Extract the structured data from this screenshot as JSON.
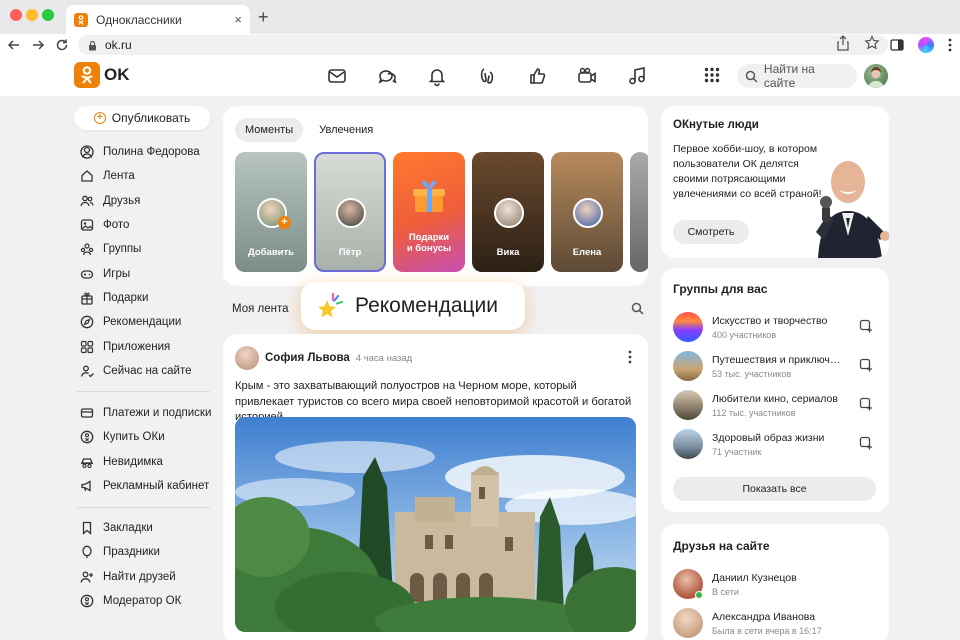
{
  "browser": {
    "tab_title": "Одноклассники",
    "tab_close": "×",
    "new_tab": "+",
    "url": "ok.ru"
  },
  "header": {
    "logo_text": "OK",
    "search_placeholder": "Найти на сайте",
    "icons": [
      "messages-icon",
      "discussions-icon",
      "notifications-icon",
      "guests-icon",
      "likes-icon",
      "video-icon",
      "music-icon"
    ]
  },
  "sidebar": {
    "publish_label": "Опубликовать",
    "group1": [
      {
        "label": "Полина Федорова",
        "icon": "profile-icon"
      },
      {
        "label": "Лента",
        "icon": "home-icon"
      },
      {
        "label": "Друзья",
        "icon": "friends-icon"
      },
      {
        "label": "Фото",
        "icon": "photo-icon"
      },
      {
        "label": "Группы",
        "icon": "groups-icon"
      },
      {
        "label": "Игры",
        "icon": "games-icon"
      },
      {
        "label": "Подарки",
        "icon": "gift-icon"
      },
      {
        "label": "Рекомендации",
        "icon": "compass-icon"
      },
      {
        "label": "Приложения",
        "icon": "apps-icon"
      },
      {
        "label": "Сейчас на сайте",
        "icon": "online-icon"
      }
    ],
    "group2": [
      {
        "label": "Платежи и подписки",
        "icon": "payments-icon"
      },
      {
        "label": "Купить ОКи",
        "icon": "coin-icon"
      },
      {
        "label": "Невидимка",
        "icon": "invisible-icon"
      },
      {
        "label": "Рекламный кабинет",
        "icon": "megaphone-icon"
      }
    ],
    "group3": [
      {
        "label": "Закладки",
        "icon": "bookmark-icon"
      },
      {
        "label": "Праздники",
        "icon": "holidays-icon"
      },
      {
        "label": "Найти друзей",
        "icon": "add-friend-icon"
      },
      {
        "label": "Модератор ОК",
        "icon": "moderator-icon"
      }
    ]
  },
  "moments": {
    "tabs": [
      "Моменты",
      "Увлечения"
    ],
    "stories": [
      {
        "label": "Добавить"
      },
      {
        "label": "Пётр"
      },
      {
        "label": "Подарки\nи бонусы"
      },
      {
        "label": "Вика"
      },
      {
        "label": "Елена"
      }
    ]
  },
  "feed": {
    "selector_label": "Моя лента",
    "badge_label": "Рекомендации"
  },
  "post": {
    "author": "София Львова",
    "time": "4 часа назад",
    "text": "Крым - это захватывающий полуостров на Черном море, который привлекает туристов со всего мира своей неповторимой красотой и богатой историей"
  },
  "ok_people": {
    "title": "ОКнутые люди",
    "description": "Первое хобби-шоу, в котором пользователи ОК делятся своими потрясающими увлечениями со всей страной!",
    "button": "Смотреть"
  },
  "groups": {
    "title": "Группы для вас",
    "items": [
      {
        "name": "Искусство и творчество",
        "members": "400 участников"
      },
      {
        "name": "Путешествия и приключения",
        "members": "53 тыс. участников"
      },
      {
        "name": "Любители кино, сериалов",
        "members": "112 тыс. участников"
      },
      {
        "name": "Здоровый образ жизни",
        "members": "71 участник"
      }
    ],
    "show_all": "Показать все"
  },
  "friends": {
    "title": "Друзья на сайте",
    "items": [
      {
        "name": "Даниил Кузнецов",
        "status": "В сети"
      },
      {
        "name": "Александра Иванова",
        "status": "Была в сети вчера в 16:17"
      }
    ]
  },
  "colors": {
    "brand": "#ee8208",
    "page_bg": "#f1f1f3",
    "card_bg": "#ffffff",
    "online": "#3ab54a"
  }
}
